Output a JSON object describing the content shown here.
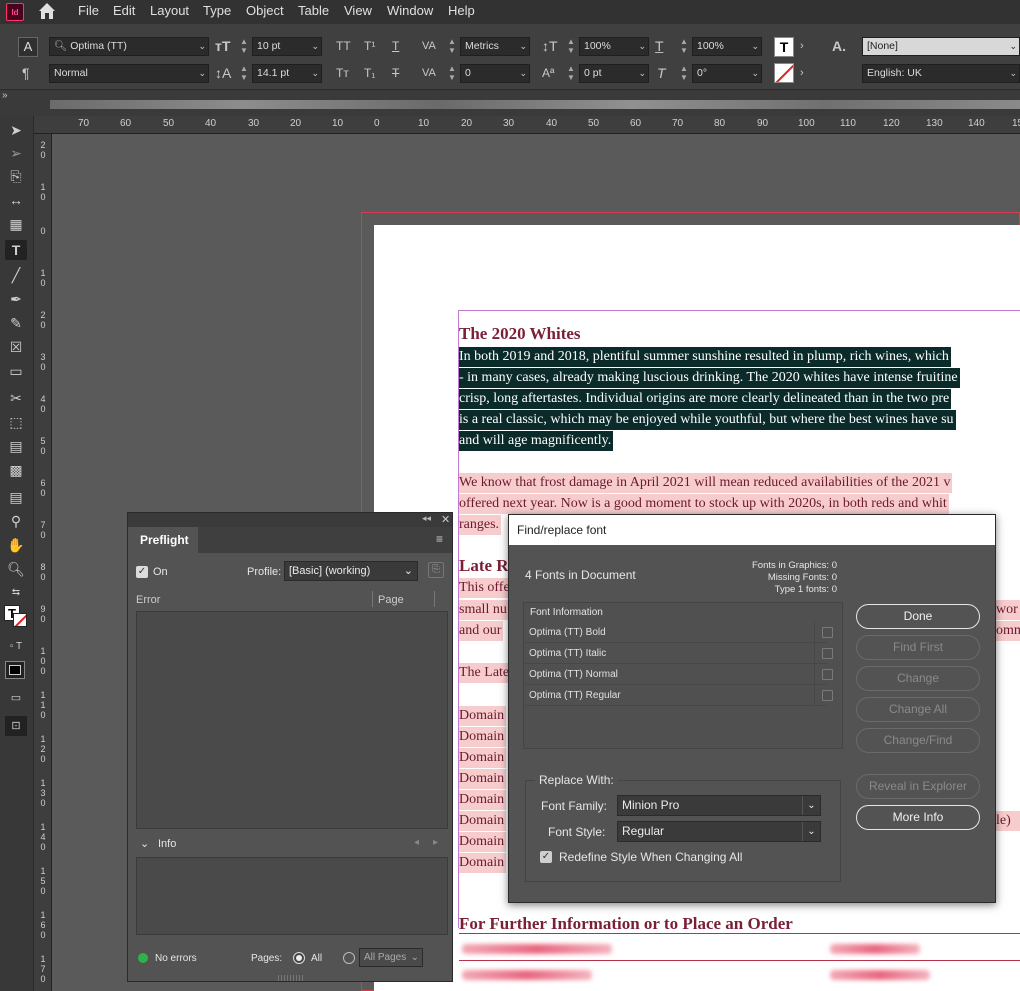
{
  "app": {
    "icon_text": "Id"
  },
  "menu": [
    "File",
    "Edit",
    "Layout",
    "Type",
    "Object",
    "Table",
    "View",
    "Window",
    "Help"
  ],
  "control": {
    "font_family": "Optima (TT)",
    "font_style": "Normal",
    "font_size": "10 pt",
    "leading": "14.1 pt",
    "kerning": "Metrics",
    "tracking": "0",
    "vscale": "100%",
    "hscale": "100%",
    "baseline_shift": "0 pt",
    "skew": "0°",
    "char_style": "[None]",
    "language": "English: UK"
  },
  "ruler": {
    "h": [
      "70",
      "60",
      "50",
      "40",
      "30",
      "20",
      "10",
      "0",
      "10",
      "20",
      "30",
      "40",
      "50",
      "60",
      "70",
      "80",
      "90",
      "100",
      "110",
      "120",
      "130",
      "140",
      "15"
    ],
    "v": [
      "2\n0",
      "1\n0",
      "0",
      "1\n0",
      "2\n0",
      "3\n0",
      "4\n0",
      "5\n0",
      "6\n0",
      "7\n0",
      "8\n0",
      "9\n0",
      "1\n0\n0",
      "1\n1\n0",
      "1\n2\n0",
      "1\n3\n0",
      "1\n4\n0",
      "1\n5\n0",
      "1\n6\n0",
      "1\n7\n0"
    ]
  },
  "document": {
    "heading1": "The 2020 Whites",
    "sel_lines": [
      "In both 2019 and 2018, plentiful summer sunshine resulted in plump, rich wines, which",
      "- in many cases, already making luscious drinking. The 2020 whites have intense fruitine",
      "crisp, long aftertastes. Individual origins are more clearly delineated than in the two pre",
      "is a real classic, which may be enjoyed while youthful, but where the best wines have su",
      "and will age magnificently."
    ],
    "para2": [
      "We know that frost damage in April 2021 will mean reduced availabilities of the 2021 v",
      "offered next year. Now is a good moment to stock up with 2020s, in both reds and whit",
      "ranges."
    ],
    "heading2": "Late R",
    "para3": [
      "This offe",
      "small nu",
      "and our"
    ],
    "para3_tail": [
      "wor",
      "omm"
    ],
    "para4": "The Late",
    "domaine": [
      "Domain",
      "Domain",
      "Domain",
      "Domain",
      "Domain",
      "Domain",
      "Domain",
      "Domain"
    ],
    "domaine_tail": "le)",
    "heading3": "For Further Information or to Place an Order"
  },
  "preflight": {
    "title": "Preflight",
    "on_label": "On",
    "profile_label": "Profile:",
    "profile_value": "[Basic] (working)",
    "col_error": "Error",
    "col_page": "Page",
    "info_label": "Info",
    "status": "No errors",
    "pages_label": "Pages:",
    "pages_all": "All",
    "pages_range": "All Pages",
    "status_color": "#2fb24a"
  },
  "dialog": {
    "title": "Find/replace font",
    "count": "4 Fonts in Document",
    "stats": [
      "Fonts in Graphics: 0",
      "Missing Fonts: 0",
      "Type 1 fonts: 0"
    ],
    "list_header": "Font Information",
    "fonts": [
      "Optima (TT) Bold",
      "Optima (TT) Italic",
      "Optima (TT) Normal",
      "Optima (TT) Regular"
    ],
    "buttons": {
      "done": "Done",
      "find_first": "Find First",
      "change": "Change",
      "change_all": "Change All",
      "change_find": "Change/Find",
      "reveal": "Reveal in Explorer",
      "more_info": "More Info"
    },
    "replace_with": "Replace With:",
    "family_label": "Font Family:",
    "family_value": "Minion Pro",
    "style_label": "Font Style:",
    "style_value": "Regular",
    "redefine": "Redefine Style When Changing All"
  },
  "colors": {
    "heading": "#7a1f35",
    "selection": "#0b2b2b",
    "highlight": "#f7cccd",
    "bleed": "#d73b55"
  }
}
